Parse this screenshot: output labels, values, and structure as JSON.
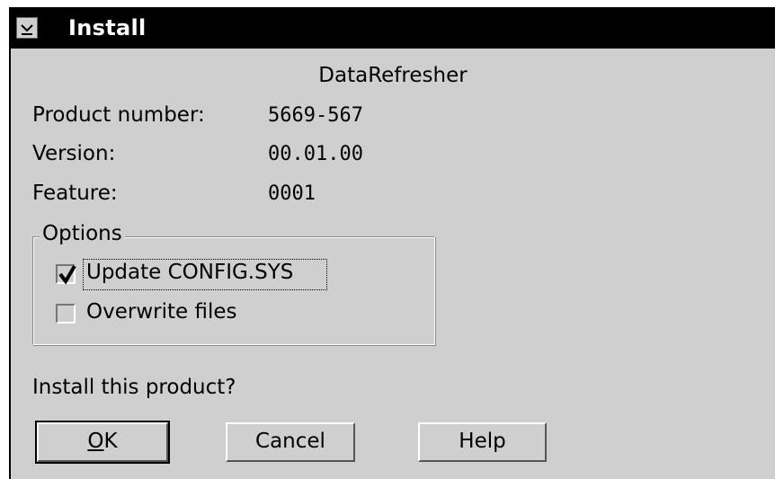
{
  "window": {
    "title": "Install",
    "system_menu_icon": "chevron-down-icon"
  },
  "product": {
    "name": "DataRefresher",
    "product_number_label": "Product number:",
    "product_number": "5669-567",
    "version_label": "Version:",
    "version": "00.01.00",
    "feature_label": "Feature:",
    "feature": "0001"
  },
  "options": {
    "group_label": "Options",
    "items": [
      {
        "label": "Update CONFIG.SYS",
        "checked": true
      },
      {
        "label": "Overwrite files",
        "checked": false
      }
    ]
  },
  "prompt": "Install this product?",
  "buttons": {
    "ok_mnemonic": "O",
    "ok_rest": "K",
    "cancel_label": "Cancel",
    "help_label": "Help"
  }
}
